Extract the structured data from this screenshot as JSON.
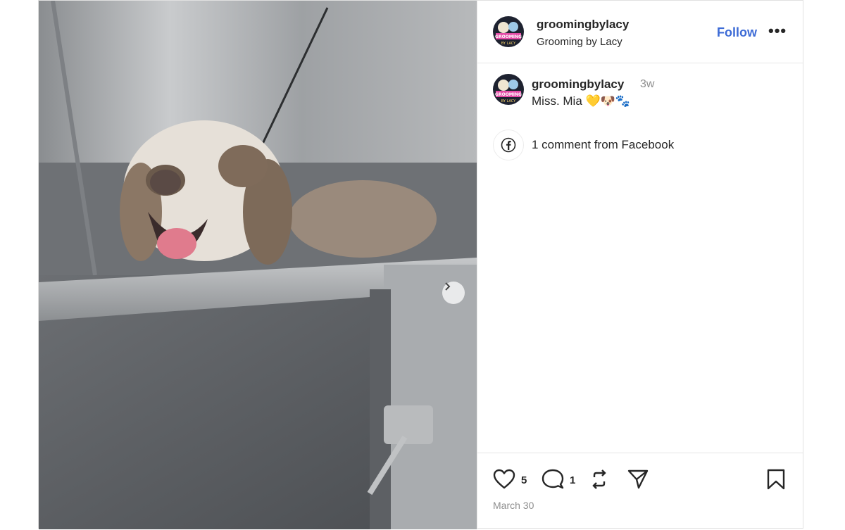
{
  "post": {
    "username": "groomingbylacy",
    "display_name": "Grooming by Lacy",
    "follow_label": "Follow",
    "more_label": "•••",
    "avatar_text_top": "GROOMING",
    "avatar_text_bottom": "BY LACY"
  },
  "caption": {
    "username": "groomingbylacy",
    "time_ago": "3w",
    "text": "Miss. Mia 💛🐶🐾"
  },
  "comments": {
    "facebook_text": "1 comment from Facebook"
  },
  "actions": {
    "likes": "5",
    "comments": "1",
    "date": "March 30"
  },
  "colors": {
    "follow": "#3d6bd6",
    "secondary_text": "#8e8e8e"
  },
  "icons": [
    "chevron-right-icon",
    "facebook-icon",
    "heart-icon",
    "comment-icon",
    "repost-icon",
    "share-icon",
    "bookmark-icon"
  ]
}
